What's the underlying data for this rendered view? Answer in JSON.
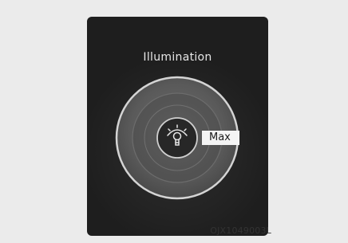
{
  "screen": {
    "title": "Illumination",
    "level_label": "Max",
    "icon": "dashboard-illumination-icon"
  },
  "caption": "OJX1049003L",
  "colors": {
    "page_background": "#ebebeb",
    "screen_background": "#1e1e1e",
    "title_text": "#e6e6e6",
    "badge_background": "#f4f4f4"
  }
}
